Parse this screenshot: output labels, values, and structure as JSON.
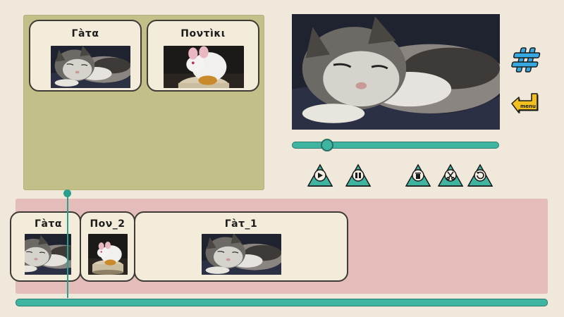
{
  "library": {
    "clips": [
      {
        "title": "Γàτα",
        "image": "sleeping-kitten"
      },
      {
        "title": "Ποντìκι",
        "image": "white-mouse"
      }
    ]
  },
  "preview": {
    "image": "sleeping-kitten"
  },
  "playback": {
    "position": 0.17
  },
  "controls": [
    "play-icon",
    "pause-icon",
    "trash-icon",
    "scissors-icon",
    "undo-icon"
  ],
  "side_buttons": {
    "hash_icon": "hash-icon",
    "menu_label": "menu"
  },
  "timeline": {
    "clips": [
      {
        "title": "Γàτα",
        "image": "sleeping-kitten"
      },
      {
        "title": "Πον_2",
        "image": "white-mouse"
      },
      {
        "title": "Γàτ_1",
        "image": "sleeping-kitten"
      }
    ]
  },
  "colors": {
    "background": "#f0e8da",
    "library_panel": "#c2c088",
    "timeline_panel": "#e4bcba",
    "accent_teal": "#3fb4a0",
    "hash_blue": "#37a9e0",
    "menu_yellow": "#f2c01e"
  }
}
